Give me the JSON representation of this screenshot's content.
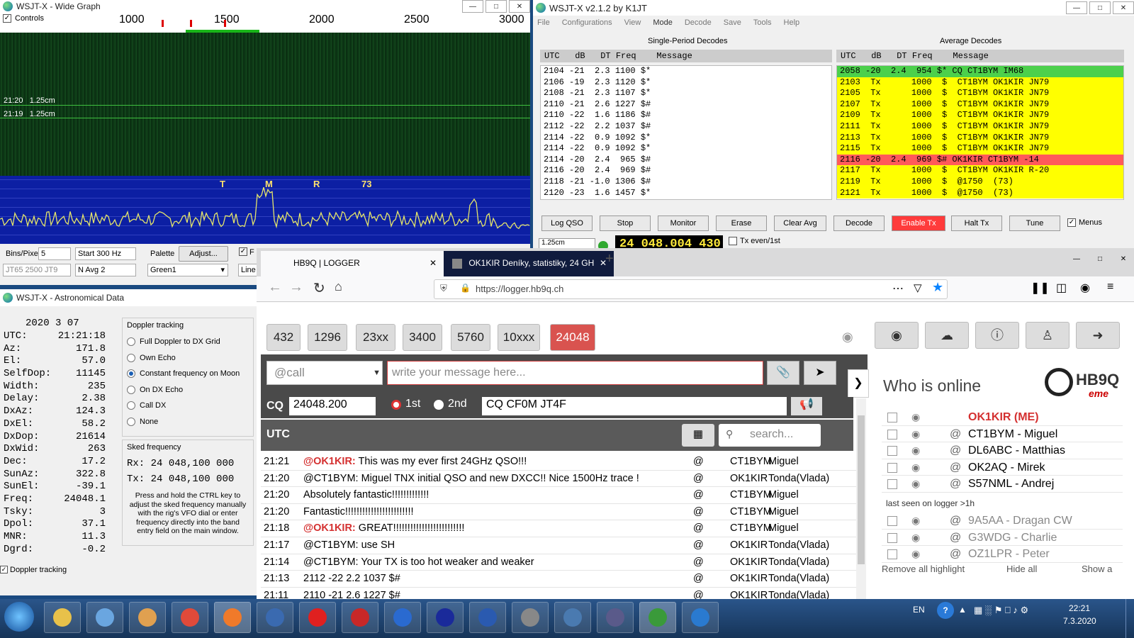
{
  "wide_graph": {
    "title": "WSJT-X - Wide Graph",
    "controls_label": "Controls",
    "scale": [
      "1000",
      "1500",
      "2000",
      "2500",
      "3000"
    ],
    "waterfall_labels": [
      {
        "time": "21:20",
        "text": "1.25cm"
      },
      {
        "time": "21:19",
        "text": "1.25cm"
      }
    ],
    "spectrum_labels": [
      "T",
      "M",
      "R",
      "73"
    ],
    "bins_label": "Bins/Pixel",
    "bins_value": "5",
    "start_label": "Start 300 Hz",
    "palette_label": "Palette",
    "adjust_label": "Adjust...",
    "mode_label": "JT65  2500  JT9",
    "navg_label": "N Avg 2",
    "palette_value": "Green1",
    "line_label": "Line",
    "f_label": "F"
  },
  "main_window": {
    "title": "WSJT-X   v2.1.2   by K1JT",
    "menu": [
      "File",
      "Configurations",
      "View",
      "Mode",
      "Decode",
      "Save",
      "Tools",
      "Help"
    ],
    "single_title": "Single-Period Decodes",
    "average_title": "Average Decodes",
    "header": "UTC   dB   DT Freq    Message",
    "single_decodes": [
      "2104 -21  2.3 1100 $*",
      "2106 -19  2.3 1120 $*",
      "2108 -21  2.3 1107 $*",
      "2110 -21  2.6 1227 $#",
      "2110 -22  1.6 1186 $#",
      "2112 -22  2.2 1037 $#",
      "2114 -22  0.9 1092 $*",
      "2114 -22  0.9 1092 $*",
      "2114 -20  2.4  965 $#",
      "2116 -20  2.4  969 $#",
      "2118 -21 -1.0 1306 $#",
      "2120 -23  1.6 1457 $*"
    ],
    "average_decodes": [
      {
        "text": "2058 -20  2.4  954 $* CQ CT1BYM IM68",
        "color": "#4cd04c"
      },
      {
        "text": "2103  Tx      1000  $  CT1BYM OK1KIR JN79",
        "color": "#ffff00"
      },
      {
        "text": "2105  Tx      1000  $  CT1BYM OK1KIR JN79",
        "color": "#ffff00"
      },
      {
        "text": "2107  Tx      1000  $  CT1BYM OK1KIR JN79",
        "color": "#ffff00"
      },
      {
        "text": "2109  Tx      1000  $  CT1BYM OK1KIR JN79",
        "color": "#ffff00"
      },
      {
        "text": "2111  Tx      1000  $  CT1BYM OK1KIR JN79",
        "color": "#ffff00"
      },
      {
        "text": "2113  Tx      1000  $  CT1BYM OK1KIR JN79",
        "color": "#ffff00"
      },
      {
        "text": "2115  Tx      1000  $  CT1BYM OK1KIR JN79",
        "color": "#ffff00"
      },
      {
        "text": "2116 -20  2.4  969 $# OK1KIR CT1BYM -14",
        "color": "#ff5a5a"
      },
      {
        "text": "2117  Tx      1000  $  CT1BYM OK1KIR R-20",
        "color": "#ffff00"
      },
      {
        "text": "2119  Tx      1000  $  @1750  (73)",
        "color": "#ffff00"
      },
      {
        "text": "2121  Tx      1000  $  @1750  (73)",
        "color": "#ffff00"
      }
    ],
    "buttons": [
      "Log QSO",
      "Stop",
      "Monitor",
      "Erase",
      "Clear Avg",
      "Decode",
      "Enable Tx",
      "Halt Tx",
      "Tune"
    ],
    "menus_label": "Menus",
    "freq_display": "24 048.004 430",
    "tx_even_label": "Tx even/1st",
    "band_small": "1.25cm"
  },
  "astro": {
    "title": "WSJT-X - Astronomical Data",
    "date": "2020 3 07",
    "rows": [
      {
        "k": "UTC:",
        "v": "21:21:18"
      },
      {
        "k": "Az:",
        "v": "171.8"
      },
      {
        "k": "El:",
        "v": "57.0"
      },
      {
        "k": "SelfDop:",
        "v": "11145"
      },
      {
        "k": "Width:",
        "v": "235"
      },
      {
        "k": "Delay:",
        "v": "2.38"
      },
      {
        "k": "DxAz:",
        "v": "124.3"
      },
      {
        "k": "DxEl:",
        "v": "58.2"
      },
      {
        "k": "DxDop:",
        "v": "21614"
      },
      {
        "k": "DxWid:",
        "v": "263"
      },
      {
        "k": "Dec:",
        "v": "17.2"
      },
      {
        "k": "SunAz:",
        "v": "322.8"
      },
      {
        "k": "SunEl:",
        "v": "-39.1"
      },
      {
        "k": "Freq:",
        "v": "24048.1"
      },
      {
        "k": "Tsky:",
        "v": "3"
      },
      {
        "k": "Dpol:",
        "v": "37.1"
      },
      {
        "k": "MNR:",
        "v": "11.3"
      },
      {
        "k": "Dgrd:",
        "v": "-0.2"
      }
    ],
    "doppler_title": "Doppler tracking",
    "doppler_options": [
      "Full Doppler to DX Grid",
      "Own Echo",
      "Constant frequency on Moon",
      "On DX Echo",
      "Call DX",
      "None"
    ],
    "doppler_selected": 2,
    "sked_title": "Sked frequency",
    "rx_label": "Rx:",
    "rx_value": "24 048,100 000",
    "tx_label": "Tx:",
    "tx_value": "24 048,100 000",
    "help_text": "Press and hold the CTRL key to adjust the sked frequency manually with the rig's VFO dial or enter frequency directly into the band entry field on the main window.",
    "doppler_checkbox": "Doppler tracking"
  },
  "browser": {
    "tab1": "HB9Q | LOGGER",
    "tab2": "OK1KIR Deníky, statistiky, 24 GH",
    "url": "https://logger.hb9q.ch",
    "bands": [
      "432",
      "1296",
      "23xx",
      "3400",
      "5760",
      "10xxx",
      "24048"
    ],
    "active_band": "24048",
    "call_placeholder": "@call",
    "message_placeholder": "write your message here...",
    "cq_label": "CQ",
    "cq_freq": "24048.200",
    "first_label": "1st",
    "second_label": "2nd",
    "cq_message": "CQ CF0M JT4F",
    "utc_label": "UTC",
    "search_placeholder": "search...",
    "messages": [
      {
        "time": "21:21",
        "mention": "@OK1KIR:",
        "text": " This was my ever first 24GHz QSO!!!",
        "call": "CT1BYM",
        "name": "Miguel"
      },
      {
        "time": "21:20",
        "mention": "",
        "text": "@CT1BYM: Miguel TNX initial QSO and new DXCC!! Nice 1500Hz trace !",
        "call": "OK1KIR",
        "name": "Tonda(Vlada)"
      },
      {
        "time": "21:20",
        "mention": "",
        "text": "Absolutely fantastic!!!!!!!!!!!!!",
        "call": "CT1BYM",
        "name": "Miguel"
      },
      {
        "time": "21:20",
        "mention": "",
        "text": "Fantastic!!!!!!!!!!!!!!!!!!!!!!!!",
        "call": "CT1BYM",
        "name": "Miguel"
      },
      {
        "time": "21:18",
        "mention": "@OK1KIR:",
        "text": " GREAT!!!!!!!!!!!!!!!!!!!!!!!!!",
        "call": "CT1BYM",
        "name": "Miguel"
      },
      {
        "time": "21:17",
        "mention": "",
        "text": "@CT1BYM: use SH",
        "call": "OK1KIR",
        "name": "Tonda(Vlada)"
      },
      {
        "time": "21:14",
        "mention": "",
        "text": "@CT1BYM: Your TX is too hot weaker and weaker",
        "call": "OK1KIR",
        "name": "Tonda(Vlada)"
      },
      {
        "time": "21:13",
        "mention": "",
        "text": "2112 -22 2.2 1037 $#",
        "call": "OK1KIR",
        "name": "Tonda(Vlada)"
      },
      {
        "time": "21:11",
        "mention": "",
        "text": "2110 -21 2.6 1227 $#",
        "call": "OK1KIR",
        "name": "Tonda(Vlada)"
      }
    ],
    "who_online_title": "Who is online",
    "logo_text": "HB9Q",
    "logo_sub": "eme",
    "online": [
      {
        "name": "OK1KIR (ME)",
        "me": true
      },
      {
        "name": "CT1BYM - Miguel",
        "me": false
      },
      {
        "name": "DL6ABC - Matthias",
        "me": false
      },
      {
        "name": "OK2AQ - Mirek",
        "me": false
      },
      {
        "name": "S57NML - Andrej",
        "me": false
      }
    ],
    "last_seen_label": "last seen on logger >1h",
    "last_seen": [
      {
        "name": "9A5AA - Dragan CW"
      },
      {
        "name": "G3WDG - Charlie"
      },
      {
        "name": "OZ1LPR - Peter"
      }
    ],
    "remove_highlight": "Remove all highlight",
    "hide_all": "Hide all",
    "show_all": "Show a"
  },
  "taskbar": {
    "lang": "EN",
    "time": "22:21",
    "date": "7.3.2020"
  }
}
